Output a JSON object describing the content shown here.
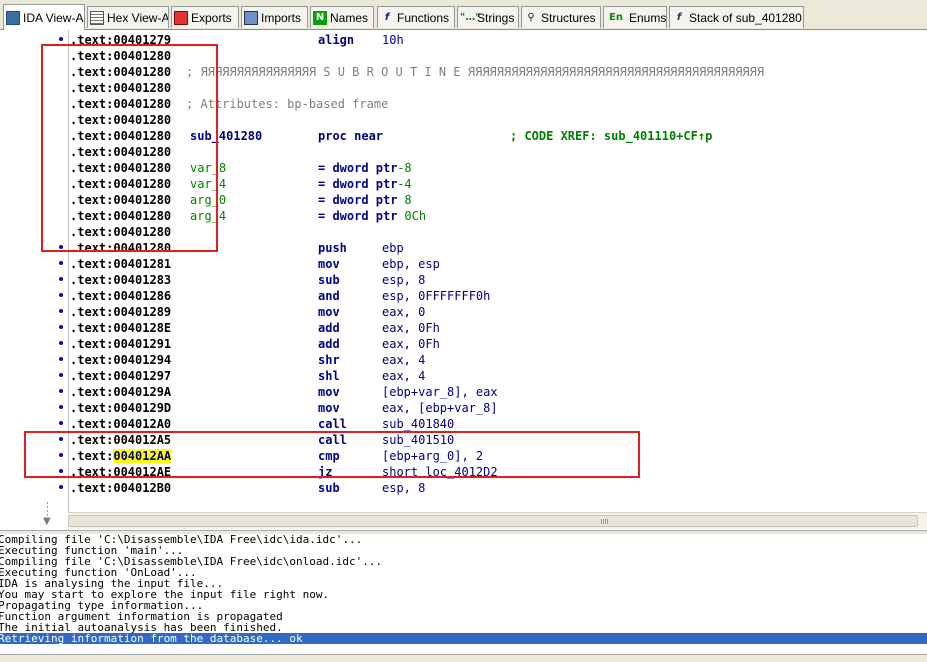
{
  "tabs": [
    {
      "label": "IDA View-A",
      "icon": "ida-view-icon",
      "active": true
    },
    {
      "label": "Hex View-A",
      "icon": "hex-view-icon"
    },
    {
      "label": "Exports",
      "icon": "exports-icon"
    },
    {
      "label": "Imports",
      "icon": "imports-icon"
    },
    {
      "label": "Names",
      "icon": "names-icon",
      "glyph": "N"
    },
    {
      "label": "Functions",
      "icon": "functions-icon",
      "glyph": "f"
    },
    {
      "label": "Strings",
      "icon": "strings-icon",
      "glyph": "\"…\""
    },
    {
      "label": "Structures",
      "icon": "structures-icon",
      "glyph": "⚲"
    },
    {
      "label": "Enums",
      "icon": "enums-icon",
      "glyph": "En"
    },
    {
      "label": "Stack of sub_401280",
      "icon": "stack-icon",
      "glyph": "f"
    }
  ],
  "disasm": {
    "lines": [
      {
        "seg": ".text:",
        "addr": "00401279",
        "dot": true,
        "mnem": "align",
        "ops": "10h"
      },
      {
        "seg": ".text:",
        "addr": "00401280"
      },
      {
        "seg": ".text:",
        "addr": "00401280",
        "comment": "; ЯЯЯЯЯЯЯЯЯЯЯЯЯЯЯЯ S U B R O U T I N E ЯЯЯЯЯЯЯЯЯЯЯЯЯЯЯЯЯЯЯЯЯЯЯЯЯЯЯЯЯЯЯЯЯЯЯЯЯЯЯЯЯ"
      },
      {
        "seg": ".text:",
        "addr": "00401280"
      },
      {
        "seg": ".text:",
        "addr": "00401280",
        "comment": "; Attributes: bp-based frame"
      },
      {
        "seg": ".text:",
        "addr": "00401280"
      },
      {
        "seg": ".text:",
        "addr": "00401280",
        "label": "sub_401280",
        "mnem": "proc near",
        "xref": "; CODE XREF: sub_401110+CF↑p"
      },
      {
        "seg": ".text:",
        "addr": "00401280"
      },
      {
        "seg": ".text:",
        "addr": "00401280",
        "var": "var_8",
        "mnem": "= dword ptr",
        "ops": "-8"
      },
      {
        "seg": ".text:",
        "addr": "00401280",
        "var": "var_4",
        "mnem": "= dword ptr",
        "ops": "-4"
      },
      {
        "seg": ".text:",
        "addr": "00401280",
        "var": "arg_0",
        "mnem": "= dword ptr",
        "ops": " 8"
      },
      {
        "seg": ".text:",
        "addr": "00401280",
        "var": "arg_4",
        "mnem": "= dword ptr",
        "ops": " 0Ch"
      },
      {
        "seg": ".text:",
        "addr": "00401280"
      },
      {
        "seg": ".text:",
        "addr": "00401280",
        "dot": true,
        "mnem": "push",
        "ops": "ebp"
      },
      {
        "seg": ".text:",
        "addr": "00401281",
        "dot": true,
        "mnem": "mov",
        "ops": "ebp, esp"
      },
      {
        "seg": ".text:",
        "addr": "00401283",
        "dot": true,
        "mnem": "sub",
        "ops": "esp, 8"
      },
      {
        "seg": ".text:",
        "addr": "00401286",
        "dot": true,
        "mnem": "and",
        "ops": "esp, 0FFFFFFF0h"
      },
      {
        "seg": ".text:",
        "addr": "00401289",
        "dot": true,
        "mnem": "mov",
        "ops": "eax, 0"
      },
      {
        "seg": ".text:",
        "addr": "0040128E",
        "dot": true,
        "mnem": "add",
        "ops": "eax, 0Fh"
      },
      {
        "seg": ".text:",
        "addr": "00401291",
        "dot": true,
        "mnem": "add",
        "ops": "eax, 0Fh"
      },
      {
        "seg": ".text:",
        "addr": "00401294",
        "dot": true,
        "mnem": "shr",
        "ops": "eax, 4"
      },
      {
        "seg": ".text:",
        "addr": "00401297",
        "dot": true,
        "mnem": "shl",
        "ops": "eax, 4"
      },
      {
        "seg": ".text:",
        "addr": "0040129A",
        "dot": true,
        "mnem": "mov",
        "ops": "[ebp+var_8], eax"
      },
      {
        "seg": ".text:",
        "addr": "0040129D",
        "dot": true,
        "mnem": "mov",
        "ops": "eax, [ebp+var_8]"
      },
      {
        "seg": ".text:",
        "addr": "004012A0",
        "dot": true,
        "mnem": "call",
        "ops": "sub_401840"
      },
      {
        "seg": ".text:",
        "addr": "004012A5",
        "dot": true,
        "mnem": "call",
        "ops": "sub_401510"
      },
      {
        "seg": ".text:",
        "addr": "004012AA",
        "dot": true,
        "highlight": true,
        "mnem": "cmp",
        "ops": "[ebp+arg_0], 2"
      },
      {
        "seg": ".text:",
        "addr": "004012AE",
        "dot": true,
        "mnem": "jz",
        "ops": "short loc_4012D2"
      },
      {
        "seg": ".text:",
        "addr": "004012B0",
        "dot": true,
        "mnem": "sub",
        "ops": "esp, 8"
      }
    ]
  },
  "output": {
    "lines": [
      "Compiling file 'C:\\Disassemble\\IDA Free\\idc\\ida.idc'...",
      "Executing function 'main'...",
      "Compiling file 'C:\\Disassemble\\IDA Free\\idc\\onload.idc'...",
      "Executing function 'OnLoad'...",
      "IDA is analysing the input file...",
      "You may start to explore the input file right now.",
      "Propagating type information...",
      "Function argument information is propagated",
      "The initial autoanalysis has been finished.",
      "Retrieving information from the database... ok"
    ],
    "selected_index": 9
  },
  "colors": {
    "accent": "#316ac5",
    "annotation": "#e02020",
    "highlight": "#ffff00",
    "name_green": "#008000",
    "keyword": "#000080"
  }
}
